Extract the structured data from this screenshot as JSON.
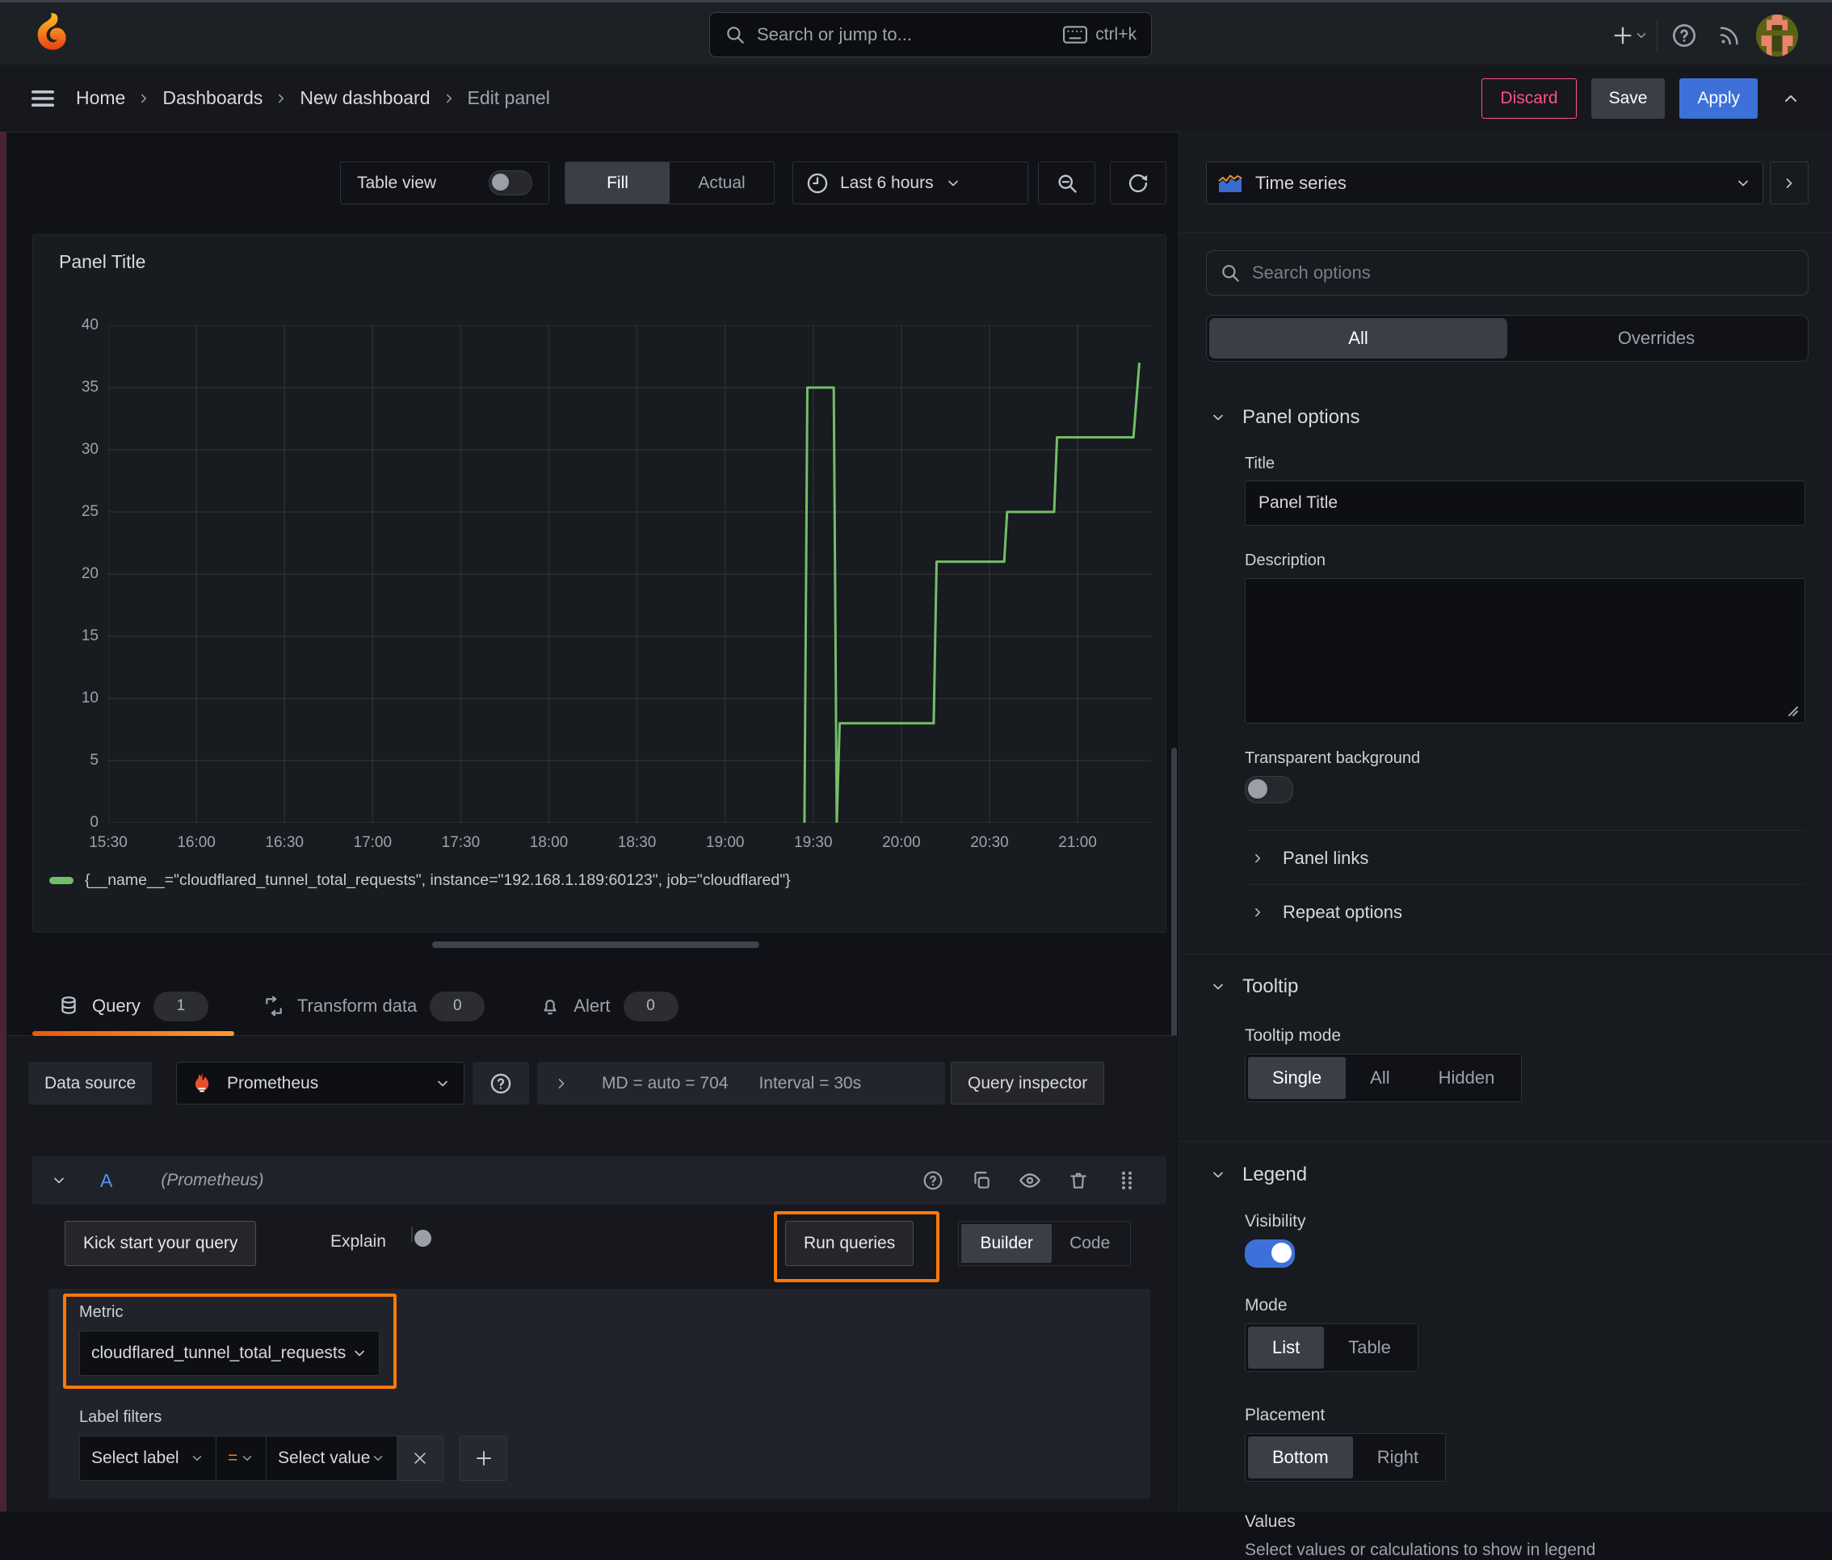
{
  "chrome": {
    "search_placeholder": "Search or jump to...",
    "search_shortcut": "ctrl+k"
  },
  "nav": {
    "breadcrumbs": [
      "Home",
      "Dashboards",
      "New dashboard",
      "Edit panel"
    ],
    "discard_label": "Discard",
    "save_label": "Save",
    "apply_label": "Apply"
  },
  "toolbar": {
    "table_view_label": "Table view",
    "fill_label": "Fill",
    "actual_label": "Actual",
    "time_range_label": "Last 6 hours"
  },
  "panel": {
    "title": "Panel Title"
  },
  "chart_data": {
    "type": "line",
    "stepped": true,
    "title": "Panel Title",
    "xlabel": "",
    "ylabel": "",
    "x_domain": [
      "15:30",
      "21:25"
    ],
    "x_ticks": [
      "15:30",
      "16:00",
      "16:30",
      "17:00",
      "17:30",
      "18:00",
      "18:30",
      "19:00",
      "19:30",
      "20:00",
      "20:30",
      "21:00"
    ],
    "ylim": [
      0,
      40
    ],
    "y_tick_step": 5,
    "grid": true,
    "legend_position": "bottom",
    "series": [
      {
        "name": "{__name__=\"cloudflared_tunnel_total_requests\", instance=\"192.168.1.189:60123\", job=\"cloudflared\"}",
        "color": "#73bf69",
        "points": [
          [
            "19:27",
            0
          ],
          [
            "19:28",
            35
          ],
          [
            "19:37",
            35
          ],
          [
            "19:38",
            0
          ],
          [
            "19:39",
            8
          ],
          [
            "20:11",
            8
          ],
          [
            "20:12",
            21
          ],
          [
            "20:35",
            21
          ],
          [
            "20:36",
            25
          ],
          [
            "20:52",
            25
          ],
          [
            "20:53",
            31
          ],
          [
            "21:19",
            31
          ],
          [
            "21:21",
            37
          ]
        ]
      }
    ]
  },
  "query": {
    "tabs": [
      {
        "label": "Query",
        "count": "1"
      },
      {
        "label": "Transform data",
        "count": "0"
      },
      {
        "label": "Alert",
        "count": "0"
      }
    ],
    "datasource_label": "Data source",
    "datasource_name": "Prometheus",
    "md_text": "MD = auto = 704",
    "interval_text": "Interval = 30s",
    "inspector_label": "Query inspector",
    "row": {
      "ref": "A",
      "ds_hint": "(Prometheus)"
    },
    "kick_start_label": "Kick start your query",
    "explain_label": "Explain",
    "run_queries_label": "Run queries",
    "builder_label": "Builder",
    "code_label": "Code",
    "metric_label": "Metric",
    "metric_value": "cloudflared_tunnel_total_requests",
    "label_filters_label": "Label filters",
    "select_label_placeholder": "Select label",
    "operator": "=",
    "select_value_placeholder": "Select value"
  },
  "sidebar": {
    "viz_name": "Time series",
    "search_placeholder": "Search options",
    "tab_all": "All",
    "tab_overrides": "Overrides",
    "panel_options": {
      "header": "Panel options",
      "title_label": "Title",
      "title_value": "Panel Title",
      "description_label": "Description",
      "transparent_label": "Transparent background"
    },
    "links_label": "Panel links",
    "repeat_label": "Repeat options",
    "tooltip": {
      "header": "Tooltip",
      "mode_label": "Tooltip mode",
      "opt_single": "Single",
      "opt_all": "All",
      "opt_hidden": "Hidden"
    },
    "legend": {
      "header": "Legend",
      "visibility_label": "Visibility",
      "mode_label": "Mode",
      "opt_list": "List",
      "opt_table": "Table",
      "placement_label": "Placement",
      "opt_bottom": "Bottom",
      "opt_right": "Right",
      "values_label": "Values",
      "values_help": "Select values or calculations to show in legend"
    }
  },
  "colors": {
    "accent_orange": "#ff780a",
    "tab_underline_from": "#e8590c",
    "tab_underline_to": "#ff9830",
    "primary_blue": "#3d71d9",
    "series_green": "#73bf69",
    "discard_pink": "#ff5286"
  }
}
